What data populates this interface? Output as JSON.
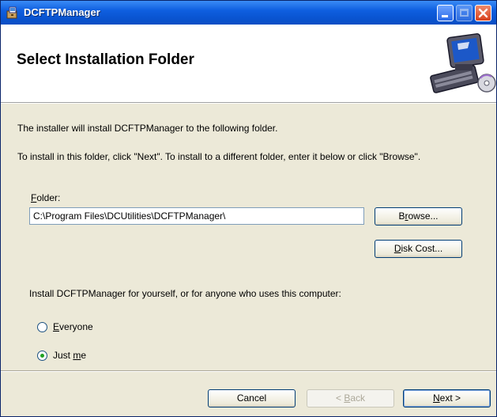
{
  "window": {
    "title": "DCFTPManager",
    "accent_color": "#0a55d2",
    "icon_name": "installer-package-icon"
  },
  "banner": {
    "title": "Select Installation Folder",
    "graphic_icon_name": "computer-install-graphic-icon"
  },
  "body": {
    "line1": "The installer will install DCFTPManager to the following folder.",
    "line2": "To install in this folder, click \"Next\". To install to a different folder, enter it below or click \"Browse\"."
  },
  "folder": {
    "label_mnemonic": "F",
    "label_rest": "older:",
    "value": "C:\\Program Files\\DCUtilities\\DCFTPManager\\"
  },
  "buttons": {
    "browse": {
      "pre": "B",
      "mn": "r",
      "post": "owse..."
    },
    "disk_cost": {
      "pre": "",
      "mn": "D",
      "post": "isk Cost..."
    },
    "cancel": {
      "pre": "Cancel",
      "mn": "",
      "post": ""
    },
    "back": {
      "pre": "< ",
      "mn": "B",
      "post": "ack"
    },
    "next": {
      "pre": "",
      "mn": "N",
      "post": "ext >"
    }
  },
  "install_for": {
    "prompt": "Install DCFTPManager for yourself, or for anyone who uses this computer:",
    "options": [
      {
        "pre": "",
        "mn": "E",
        "post": "veryone",
        "selected": false
      },
      {
        "pre": "Just ",
        "mn": "m",
        "post": "e",
        "selected": true
      }
    ]
  }
}
